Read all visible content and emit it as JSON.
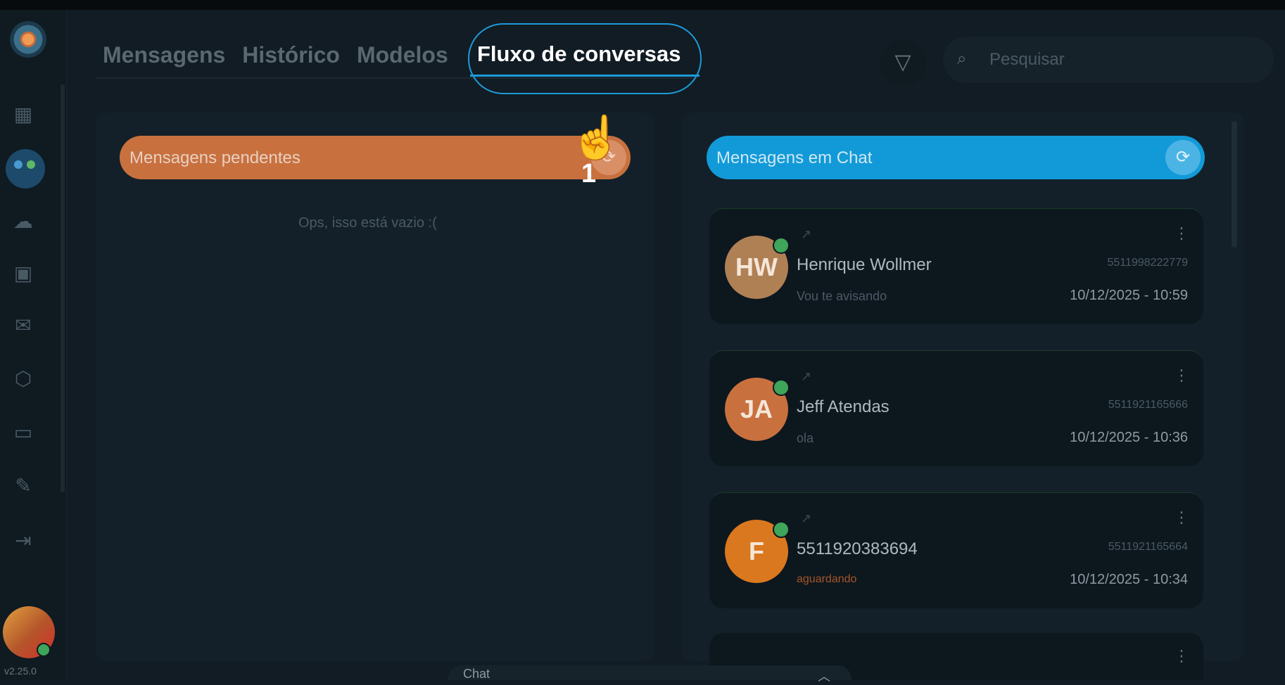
{
  "version": "v2.25.0",
  "tabs": [
    {
      "label": "Mensagens"
    },
    {
      "label": "Histórico"
    },
    {
      "label": "Modelos"
    },
    {
      "label": "Fluxo de conversas"
    }
  ],
  "search": {
    "placeholder": "Pesquisar"
  },
  "pending": {
    "title": "Mensagens pendentes",
    "empty": "Ops, isso está vazio :("
  },
  "chat": {
    "title": "Mensagens em Chat"
  },
  "annotation": {
    "hand": "☝️",
    "step": "1"
  },
  "conversations": [
    {
      "initials": "HW",
      "name": "Henrique Wollmer",
      "phone": "5511998222779",
      "message": "Vou te avisando",
      "time": "10/12/2025 - 10:59",
      "color": "#b08055"
    },
    {
      "initials": "JA",
      "name": "Jeff Atendas",
      "phone": "5511921165666",
      "message": "ola",
      "time": "10/12/2025 - 10:36",
      "color": "#c8713f"
    },
    {
      "initials": "F",
      "name": "5511920383694",
      "phone": "5511921165664",
      "tag": "aguardando",
      "time": "10/12/2025 - 10:34",
      "color": "#d9781f"
    }
  ],
  "bottom_tab": {
    "label": "Chat"
  },
  "colors": {
    "accent": "#1e9ad8",
    "pending": "#c8713f",
    "chat": "#129ad8",
    "online": "#3ea55a"
  }
}
